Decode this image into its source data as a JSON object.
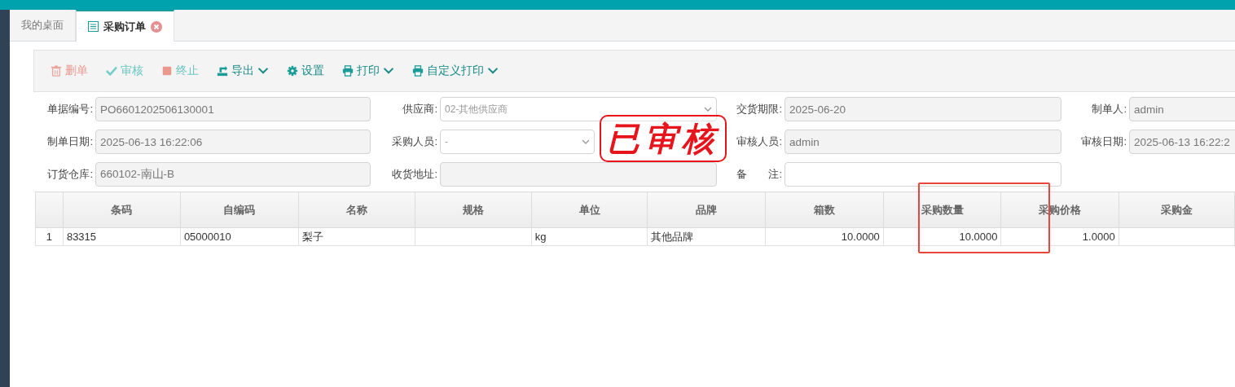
{
  "tabs": [
    {
      "label": "我的桌面",
      "selected": false,
      "closable": false
    },
    {
      "label": "采购订单",
      "selected": true,
      "closable": true
    }
  ],
  "toolbar": [
    {
      "kind": "delete",
      "label": "删单",
      "disabled": true,
      "dropdown": false
    },
    {
      "kind": "approve",
      "label": "审核",
      "disabled": true,
      "dropdown": false
    },
    {
      "kind": "stop",
      "label": "终止",
      "disabled": true,
      "dropdown": false
    },
    {
      "kind": "export",
      "label": "导出",
      "disabled": false,
      "dropdown": true
    },
    {
      "kind": "settings",
      "label": "设置",
      "disabled": false,
      "dropdown": false
    },
    {
      "kind": "print",
      "label": "打印",
      "disabled": false,
      "dropdown": true
    },
    {
      "kind": "print",
      "label": "自定义打印",
      "disabled": false,
      "dropdown": true
    }
  ],
  "form": [
    [
      {
        "label": "单据编号:",
        "value": "PO6601202506130001",
        "kind": "text"
      },
      {
        "label": "供应商:",
        "value": "02-其他供应商",
        "kind": "select"
      },
      {
        "label": "交货期限:",
        "value": "2025-06-20",
        "kind": "text"
      },
      {
        "label": "制单人:",
        "value": "admin",
        "kind": "text"
      }
    ],
    [
      {
        "label": "制单日期:",
        "value": "2025-06-13 16:22:06",
        "kind": "text"
      },
      {
        "label": "采购人员:",
        "value": "-",
        "kind": "select"
      },
      {
        "label": "审核人员:",
        "value": "admin",
        "kind": "text"
      },
      {
        "label": "审核日期:",
        "value": "2025-06-13 16:22:2",
        "kind": "text"
      }
    ],
    [
      {
        "label": "订货仓库:",
        "value": "660102-南山-B",
        "kind": "text"
      },
      {
        "label": "收货地址:",
        "kind": "text"
      },
      {
        "label": "备　　注:",
        "kind": "editable"
      }
    ]
  ],
  "stamp": "已审核",
  "table": {
    "columns": [
      {
        "label": "条码",
        "highlighted": false
      },
      {
        "label": "自编码",
        "highlighted": false
      },
      {
        "label": "名称",
        "highlighted": false
      },
      {
        "label": "规格",
        "highlighted": false
      },
      {
        "label": "单位",
        "highlighted": false
      },
      {
        "label": "品牌",
        "highlighted": false
      },
      {
        "label": "箱数",
        "highlighted": false
      },
      {
        "label": "采购数量",
        "highlighted": true
      },
      {
        "label": "采购价格",
        "highlighted": false
      },
      {
        "label": "采购金",
        "highlighted": false
      }
    ],
    "rows": [
      {
        "number": "1",
        "cells": [
          "83315",
          "05000010",
          "梨子",
          null,
          "kg",
          "其他品牌",
          "10.0000",
          "10.0000",
          "1.0000",
          null
        ]
      }
    ]
  }
}
